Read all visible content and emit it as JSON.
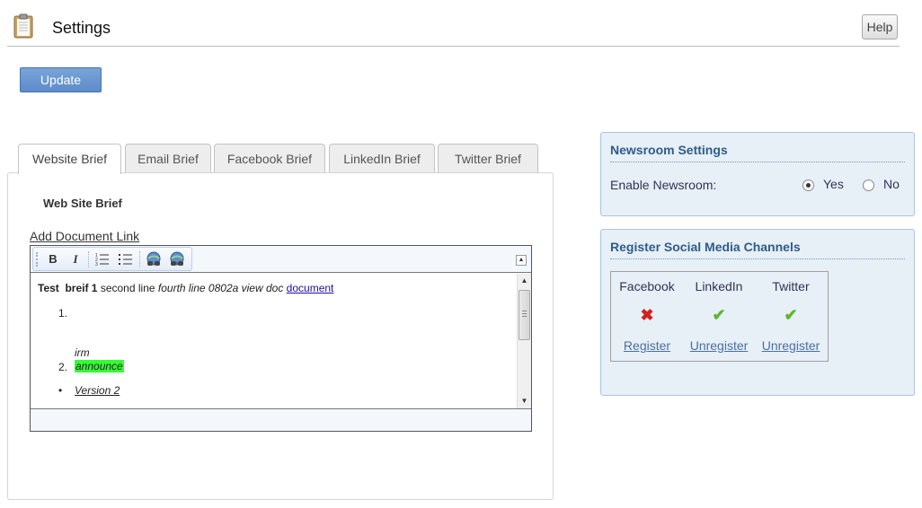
{
  "header": {
    "title": "Settings",
    "help_label": "Help"
  },
  "actions": {
    "update_label": "Update"
  },
  "tabs": [
    {
      "label": "Website Brief",
      "active": true
    },
    {
      "label": "Email Brief",
      "active": false
    },
    {
      "label": "Facebook Brief",
      "active": false
    },
    {
      "label": "LinkedIn Brief",
      "active": false
    },
    {
      "label": "Twitter Brief",
      "active": false
    }
  ],
  "brief": {
    "title": "Web Site Brief",
    "add_link": "Add Document Link",
    "toolbar": {
      "bold": "B",
      "italic": "I",
      "items": [
        "bold-icon",
        "italic-icon",
        "numbered-list-icon",
        "bullet-list-icon",
        "insert-link-icon",
        "remove-link-icon"
      ]
    },
    "content": {
      "line1": {
        "bold1": "Test",
        "bold2": "breif 1",
        "normal": "second line",
        "italic": "fourth line 0802a view doc",
        "link": "document"
      },
      "num1": "1.",
      "italic_irm": "irm",
      "num2": "2.",
      "highlight": "announce",
      "bullet": "•",
      "version": "Version 2"
    },
    "highlight_color": "#33ff33"
  },
  "newsroom": {
    "title": "Newsroom Settings",
    "enable_label": "Enable Newsroom:",
    "yes_label": "Yes",
    "no_label": "No",
    "selected": "Yes"
  },
  "social": {
    "title": "Register Social Media Channels",
    "channels": [
      {
        "name": "Facebook",
        "status": "not-registered",
        "icon": "red-x-icon",
        "action": "Register"
      },
      {
        "name": "LinkedIn",
        "status": "registered",
        "icon": "green-check-icon",
        "action": "Unregister"
      },
      {
        "name": "Twitter",
        "status": "registered",
        "icon": "green-check-icon",
        "action": "Unregister"
      }
    ]
  },
  "colors": {
    "accent_button": "#6a97d0",
    "side_panel_bg": "#e7eff7",
    "side_title": "#2e5c8a",
    "check_green": "#5cb82b",
    "x_red": "#d42020"
  }
}
